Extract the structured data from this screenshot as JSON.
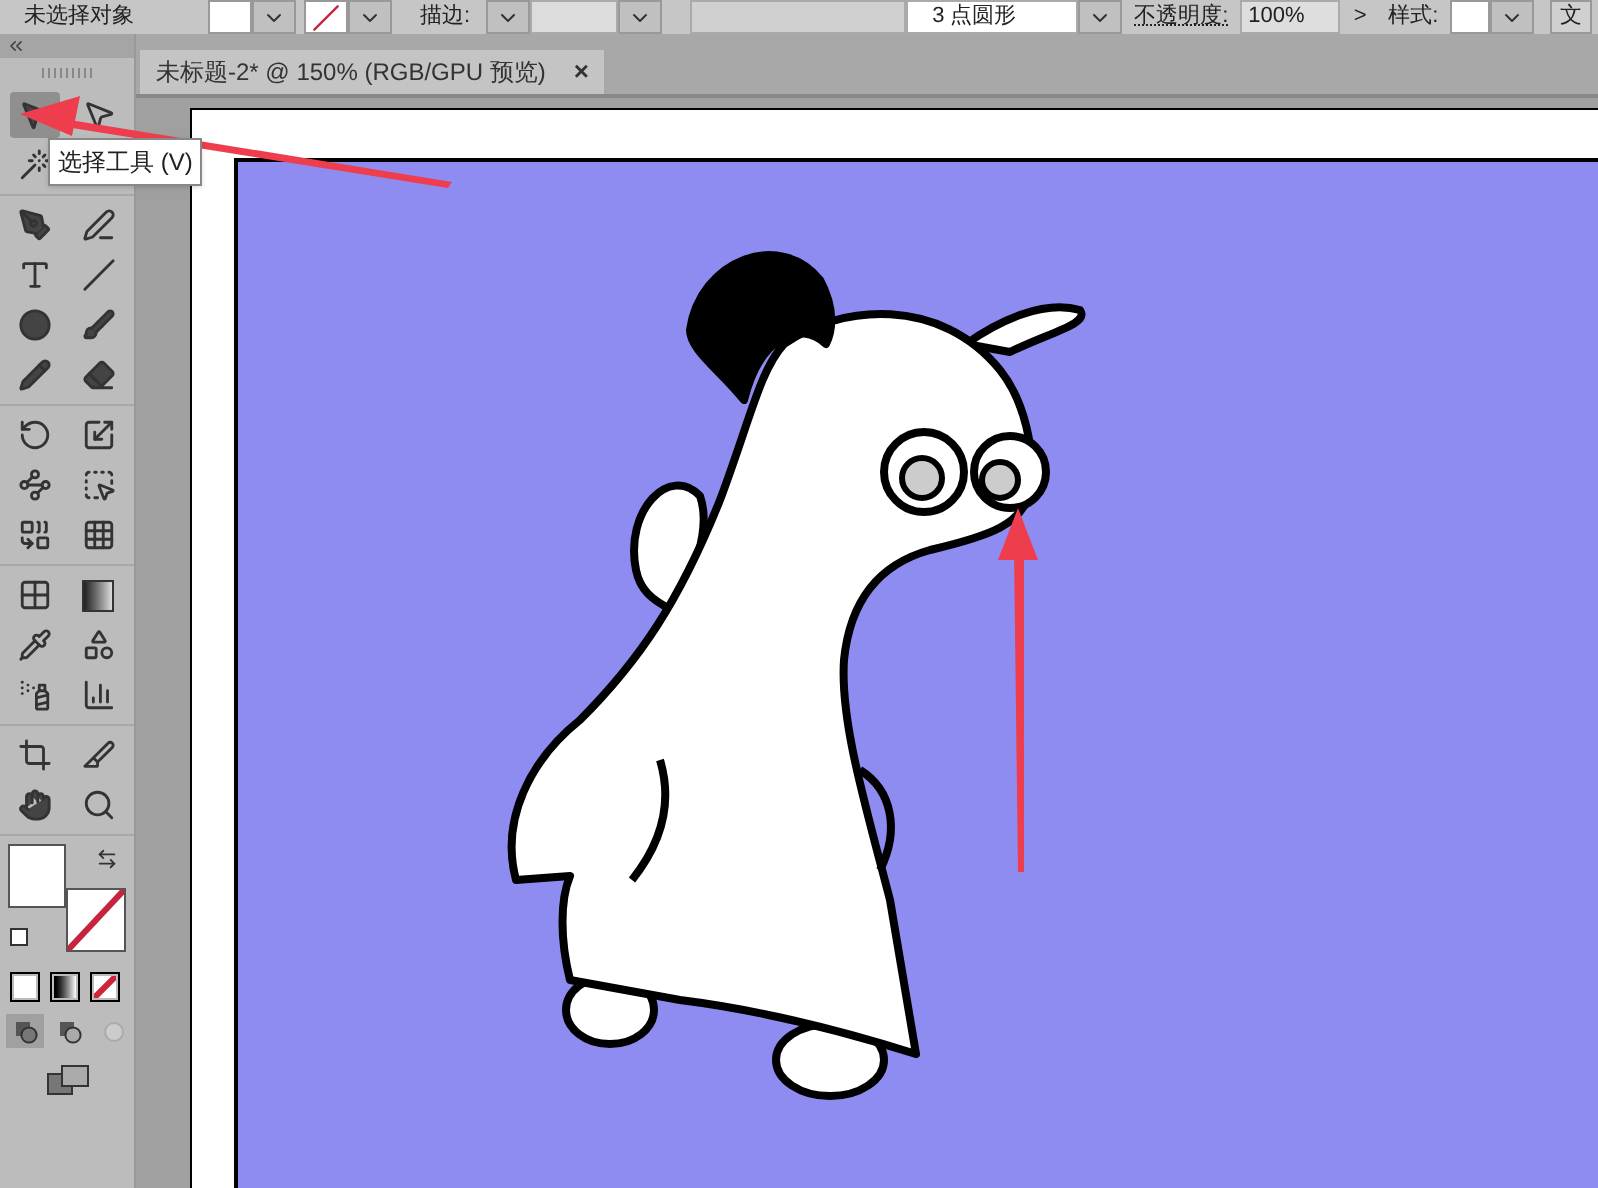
{
  "control_bar": {
    "selection_label": "未选择对象",
    "stroke_label": "描边:",
    "brush_definition": "3 点圆形",
    "opacity_label": "不透明度:",
    "opacity_value": "100%",
    "opacity_arrow": ">",
    "style_label": "样式:",
    "button_label": "文"
  },
  "document_tab": {
    "title": "未标题-2* @ 150% (RGB/GPU 预览)",
    "close": "×",
    "selected": true
  },
  "tools": [
    {
      "kind": "select",
      "selected": true
    },
    {
      "kind": "direct-select",
      "selected": false
    },
    {
      "kind": "magic-wand",
      "selected": false
    },
    {
      "kind": "pen",
      "selected": false
    },
    {
      "kind": "curvature",
      "selected": false
    },
    {
      "kind": "type",
      "selected": false
    },
    {
      "kind": "line",
      "selected": false
    },
    {
      "kind": "ellipse",
      "selected": false
    },
    {
      "kind": "brush",
      "selected": false
    },
    {
      "kind": "pencil",
      "selected": false
    },
    {
      "kind": "eraser",
      "selected": false
    },
    {
      "kind": "rotate",
      "selected": false
    },
    {
      "kind": "scale",
      "selected": false
    },
    {
      "kind": "puppet",
      "selected": false
    },
    {
      "kind": "free-transform",
      "selected": false
    },
    {
      "kind": "shape-builder",
      "selected": false
    },
    {
      "kind": "perspective",
      "selected": false
    },
    {
      "kind": "mesh",
      "selected": false
    },
    {
      "kind": "gradient",
      "selected": false
    },
    {
      "kind": "eyedropper",
      "selected": false
    },
    {
      "kind": "blend",
      "selected": false
    },
    {
      "kind": "symbol-sprayer",
      "selected": false
    },
    {
      "kind": "graph",
      "selected": false
    },
    {
      "kind": "artboard",
      "selected": false
    },
    {
      "kind": "slice",
      "selected": false
    },
    {
      "kind": "hand",
      "selected": false
    },
    {
      "kind": "zoom",
      "selected": false
    }
  ],
  "tooltip": "选择工具 (V)",
  "color_modes": [
    {
      "kind": "color",
      "selected": false
    },
    {
      "kind": "gradient",
      "selected": false
    },
    {
      "kind": "none",
      "selected": false
    }
  ],
  "draw_modes": [
    {
      "kind": "normal",
      "selected": true
    },
    {
      "kind": "behind",
      "selected": false
    },
    {
      "kind": "inside",
      "selected": false
    }
  ]
}
